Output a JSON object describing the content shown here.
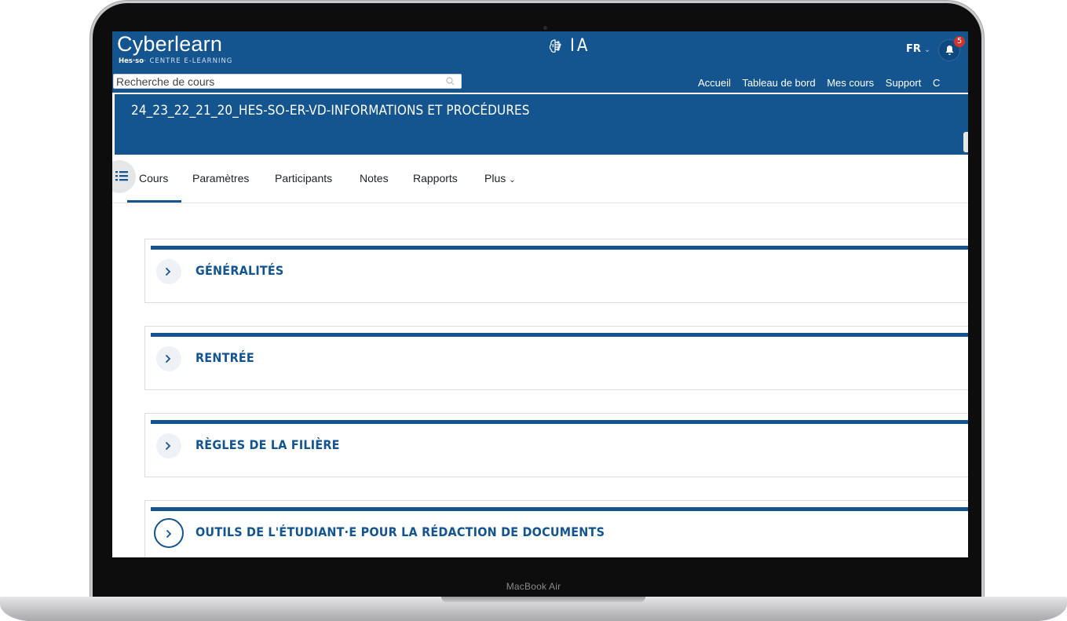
{
  "device": {
    "label": "MacBook Air"
  },
  "header": {
    "logo_title": "Cyberlearn",
    "logo_sub_brand": "Hes·so",
    "logo_sub_text": "· CENTRE E-LEARNING",
    "ai_label": "IA",
    "language": "FR",
    "notification_count": "5",
    "search": {
      "placeholder": "Recherche de cours"
    },
    "nav": [
      "Accueil",
      "Tableau de bord",
      "Mes cours",
      "Support",
      "C"
    ]
  },
  "course": {
    "title": "24_23_22_21_20_HES-SO-ER-VD-INFORMATIONS ET PROCÉDURES"
  },
  "tabs": [
    "Cours",
    "Paramètres",
    "Participants",
    "Notes",
    "Rapports",
    "Plus"
  ],
  "active_tab": "Cours",
  "sections": [
    {
      "title": "GÉNÉRALITÉS"
    },
    {
      "title": "RENTRÉE"
    },
    {
      "title": "RÈGLES DE LA FILIÈRE"
    },
    {
      "title": "OUTILS DE L'ÉTUDIANT·E POUR LA RÉDACTION DE DOCUMENTS"
    }
  ],
  "colors": {
    "brand": "#14548f",
    "badge": "#d0342c"
  }
}
